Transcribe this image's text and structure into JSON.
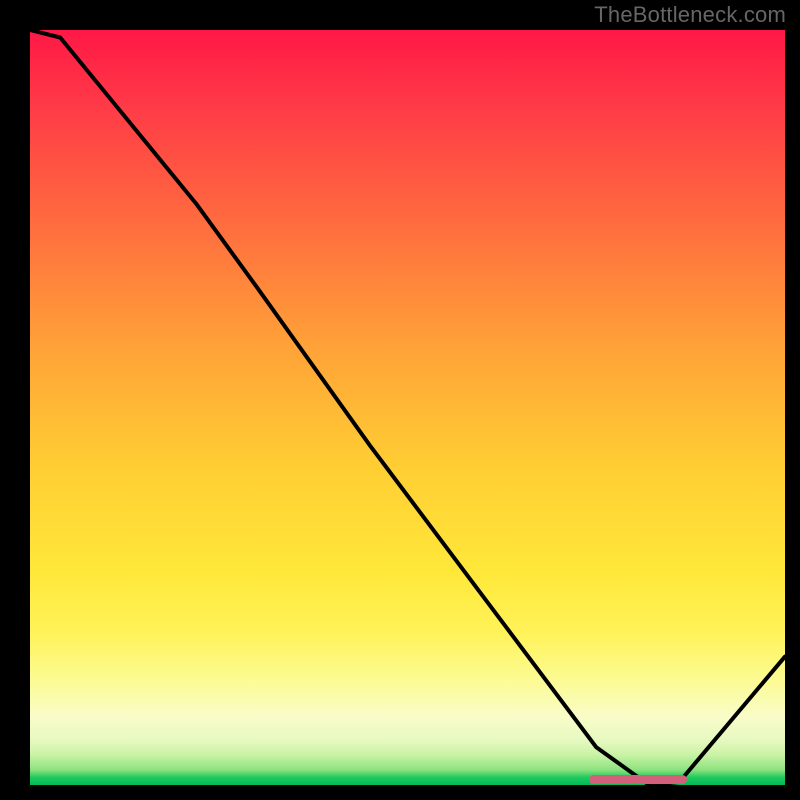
{
  "watermark": "TheBottleneck.com",
  "colors": {
    "frame": "#000000",
    "curve": "#000000",
    "marker": "#d2607a",
    "gradient_top": "#ff1846",
    "gradient_bottom": "#00bc56"
  },
  "chart_data": {
    "type": "line",
    "title": "",
    "xlabel": "",
    "ylabel": "",
    "xlim": [
      0,
      100
    ],
    "ylim": [
      0,
      100
    ],
    "x": [
      0,
      4,
      22,
      30,
      45,
      60,
      75,
      82,
      86,
      100
    ],
    "values": [
      100,
      99,
      77,
      66,
      45,
      25,
      5,
      0,
      0.4,
      17
    ],
    "marker": {
      "x_start": 74,
      "x_end": 87,
      "y": 0
    },
    "notes": "Values read approximately from the plotted curve; y=0 is the bottom (green) edge, y=100 is the top (red) edge."
  }
}
